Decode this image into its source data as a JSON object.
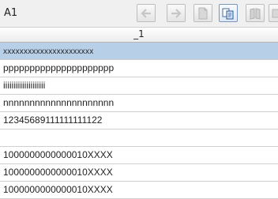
{
  "toolbar": {
    "cell_reference": "A1",
    "buttons": [
      {
        "name": "back-arrow-button",
        "icon": "arrow-left-icon",
        "state": "disabled"
      },
      {
        "name": "forward-arrow-button",
        "icon": "arrow-right-icon",
        "state": "disabled"
      },
      {
        "name": "document-button",
        "icon": "document-icon",
        "state": "disabled"
      },
      {
        "name": "copy-button",
        "icon": "copy-icon",
        "state": "active"
      },
      {
        "name": "book-button",
        "icon": "book-icon",
        "state": "disabled"
      },
      {
        "name": "export-button",
        "icon": "export-icon",
        "state": "disabled"
      }
    ]
  },
  "table": {
    "column_header": "_1",
    "rows": [
      "xxxxxxxxxxxxxxxxxxxxxx",
      "ppppppppppppppppppppp",
      "iiiiiiiiiiiiiiiiiiii",
      "nnnnnnnnnnnnnnnnnnnnn",
      "12345689111111111122",
      "",
      "1000000000000010XXXX",
      "1000000000000010XXXX",
      "1000000000000010XXXX"
    ],
    "selected_row": 0
  },
  "colors": {
    "selection": "#b8cfe8",
    "toolbar_bg": "#f0f0f0",
    "grid_line": "#cfcfcf"
  }
}
